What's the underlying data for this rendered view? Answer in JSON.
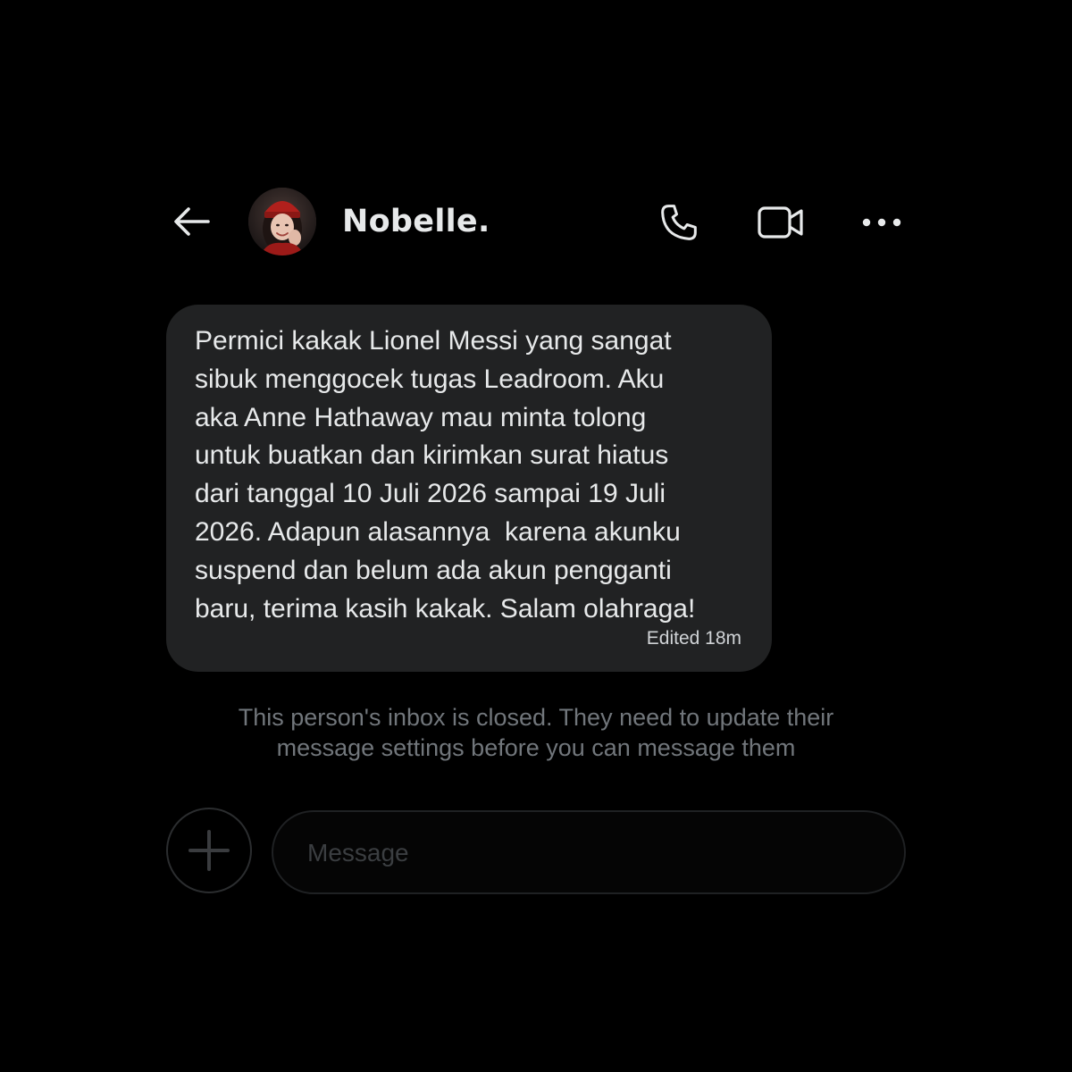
{
  "header": {
    "contact_name": "Nobelle.",
    "back_icon": "arrow-left-icon",
    "phone_icon": "phone-icon",
    "video_icon": "video-camera-icon",
    "more_icon": "more-horizontal-icon"
  },
  "message": {
    "text_lines": [
      "Permici kakak Lionel Messi yang sangat",
      "sibuk menggocek tugas Leadroom. Aku",
      "aka Anne Hathaway mau minta tolong",
      "untuk buatkan dan kirimkan surat hiatus",
      "dari tanggal 10 Juli 2026 sampai 19 Juli",
      "2026. Adapun alasannya  karena akunku",
      "suspend dan belum ada akun pengganti",
      "baru, terima kasih kakak. Salam olahraga!"
    ],
    "meta": "Edited 18m"
  },
  "notice": {
    "line1": "This person's inbox is closed. They need to update their",
    "line2": "message settings before you can message them"
  },
  "composer": {
    "add_icon": "plus-icon",
    "placeholder": "Message"
  },
  "colors": {
    "background": "#000000",
    "bubble": "#212223",
    "text": "#e7e9ea",
    "muted": "#71767b"
  }
}
